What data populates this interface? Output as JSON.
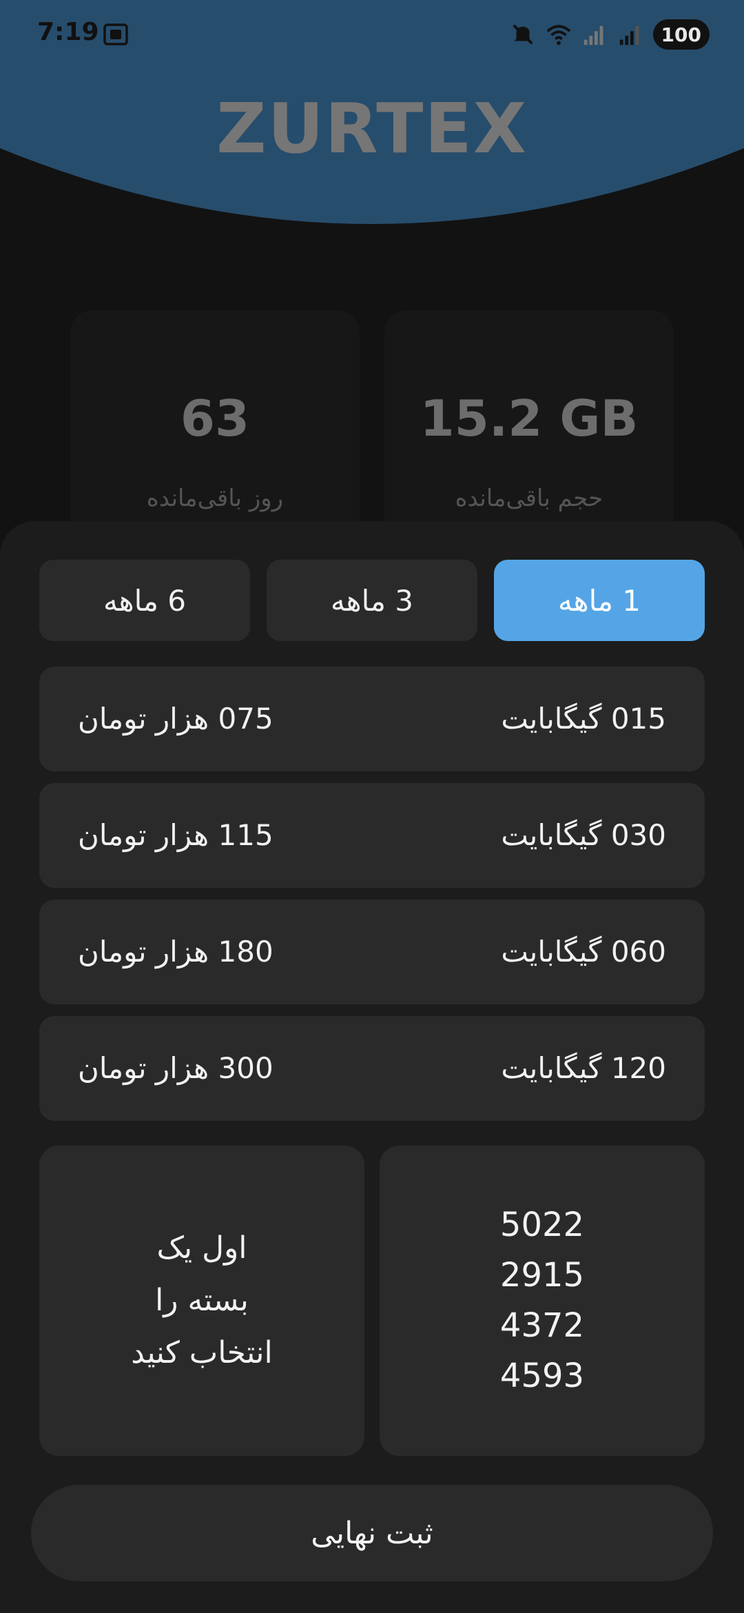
{
  "status_bar": {
    "time": "7:19",
    "battery": "100",
    "icons": [
      "screenshot-icon",
      "mute-icon",
      "wifi-icon",
      "signal-icon",
      "signal-icon"
    ]
  },
  "header": {
    "brand": "ZURTEX",
    "background_color": "#274d6c"
  },
  "stats": {
    "days_value": "63",
    "days_label": "روز باقی‌مانده",
    "volume_value": "15.2 GB",
    "volume_label": "حجم باقی‌مانده"
  },
  "tabs": [
    {
      "label": "6 ماهه",
      "active": false
    },
    {
      "label": "3 ماهه",
      "active": false
    },
    {
      "label": "1 ماهه",
      "active": true
    }
  ],
  "plans": [
    {
      "volume": "015 گیگابایت",
      "price": "075 هزار تومان"
    },
    {
      "volume": "030 گیگابایت",
      "price": "115 هزار تومان"
    },
    {
      "volume": "060 گیگابایت",
      "price": "180 هزار تومان"
    },
    {
      "volume": "120 گیگابایت",
      "price": "300 هزار تومان"
    }
  ],
  "selection_hint": {
    "line1": "اول یک",
    "line2": "بسته را",
    "line3": "انتخاب کنید"
  },
  "card_number": {
    "line1": "5022",
    "line2": "2915",
    "line3": "4372",
    "line4": "4593"
  },
  "submit_label": "ثبت نهایی",
  "colors": {
    "accent": "#55a5e6",
    "background": "#121212",
    "sheet": "#1c1c1c",
    "surface": "#2a2a2a"
  }
}
